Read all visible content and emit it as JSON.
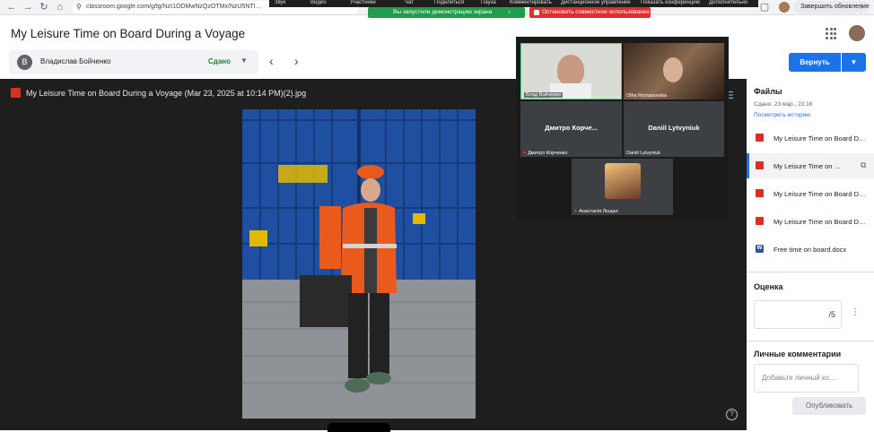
{
  "browser": {
    "url": "classroom.google.com/g/tg/NzI1ODMwNzQzOTMx/NzU5NTI…",
    "update_button": "Завершить обновление"
  },
  "meeting_toolbar": {
    "items": [
      "Звук",
      "Видео",
      "Участники",
      "Чат",
      "Поделиться",
      "Пауза",
      "Комментировать",
      "Дистанционное управление",
      "Показать конференцию",
      "Дополнительно"
    ],
    "demo_notice": "Вы запустили демонстрацию экрана",
    "stop_share": "Остановить совместное использование"
  },
  "header": {
    "title": "My Leisure Time on Board During a Voyage"
  },
  "student": {
    "initial": "В",
    "name": "Владислав Бойченко",
    "status": "Сдано"
  },
  "return_button": "Вернуть",
  "viewer": {
    "file_title": "My Leisure Time on Board During a Voyage (Mar 23, 2025 at 10:14 PM)(2).jpg"
  },
  "meet": {
    "participants": [
      {
        "label": "Влад Бойченко"
      },
      {
        "label": "Olha Romanovska"
      },
      {
        "big_name": "Дмитро  Корче...",
        "label": "Дмитро Корченко"
      },
      {
        "big_name": "Daniil Lytvyniuk",
        "label": "Daniil Lytvyniuk"
      },
      {
        "label": "Анастасія Лєщан"
      }
    ]
  },
  "files_panel": {
    "header": "Файлы",
    "submitted": "Сдано: 23 мар., 23:16",
    "history_link": "Посмотреть историю",
    "files": [
      {
        "name": "My Leisure Time on Board D…",
        "type": "image"
      },
      {
        "name": "My Leisure Time on …",
        "type": "image"
      },
      {
        "name": "My Leisure Time on Board D…",
        "type": "image"
      },
      {
        "name": "My Leisure Time on Board D…",
        "type": "image"
      },
      {
        "name": "Free time on board.docx",
        "type": "word"
      }
    ]
  },
  "grade": {
    "header": "Оценка",
    "max": "/5"
  },
  "comments": {
    "header": "Личные комментарии",
    "placeholder": "Добавьте личный ко…",
    "publish": "Опубликовать"
  },
  "colors": {
    "accent": "#1a73e8",
    "status_green": "#188038",
    "image_file": "#d93025",
    "share_green": "#1e9e4b",
    "stop_red": "#e02d2d"
  }
}
